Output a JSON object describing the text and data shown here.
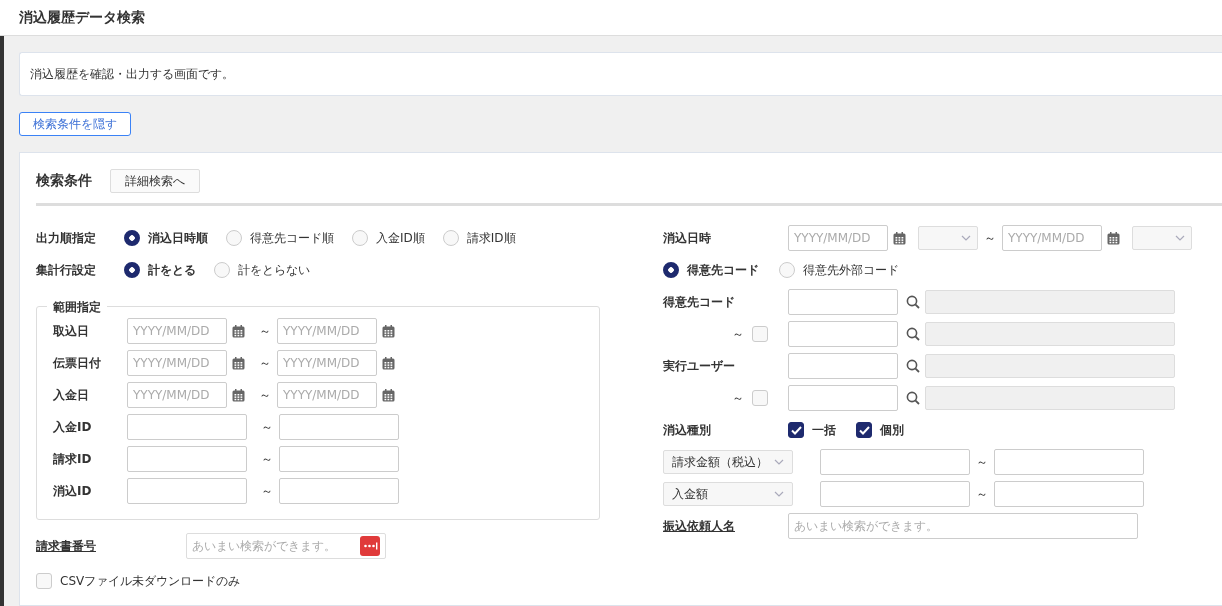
{
  "title": "消込履歴データ検索",
  "description": "消込履歴を確認・出力する画面です。",
  "toggle_button": "検索条件を隠す",
  "conditions": {
    "heading": "検索条件",
    "detail_button": "詳細検索へ"
  },
  "radio_groups": [
    {
      "label": "出力順指定",
      "options": [
        {
          "label": "消込日時順",
          "selected": true
        },
        {
          "label": "得意先コード順",
          "selected": false
        },
        {
          "label": "入金ID順",
          "selected": false
        },
        {
          "label": "請求ID順",
          "selected": false
        }
      ]
    },
    {
      "label": "集計行設定",
      "options": [
        {
          "label": "計をとる",
          "selected": true
        },
        {
          "label": "計をとらない",
          "selected": false
        }
      ]
    }
  ],
  "range": {
    "legend": "範囲指定",
    "rows": [
      {
        "label": "取込日",
        "kind": "date",
        "from_placeholder": "YYYY/MM/DD",
        "tilde": "～",
        "to_placeholder": "YYYY/MM/DD"
      },
      {
        "label": "伝票日付",
        "kind": "date",
        "from_placeholder": "YYYY/MM/DD",
        "tilde": "～",
        "to_placeholder": "YYYY/MM/DD"
      },
      {
        "label": "入金日",
        "kind": "date",
        "from_placeholder": "YYYY/MM/DD",
        "tilde": "～",
        "to_placeholder": "YYYY/MM/DD"
      },
      {
        "label": "入金ID",
        "kind": "text",
        "tilde": "～"
      },
      {
        "label": "請求ID",
        "kind": "text",
        "tilde": "～"
      },
      {
        "label": "消込ID",
        "kind": "text",
        "tilde": "～"
      }
    ]
  },
  "invoice_number": {
    "label": "請求書番号",
    "placeholder": "あいまい検索ができます。"
  },
  "csv_only": {
    "label": "CSVファイル未ダウンロードのみ",
    "checked": false
  },
  "cleared_datetime": {
    "label": "消込日時",
    "from_placeholder": "YYYY/MM/DD",
    "tilde": "～",
    "to_placeholder": "YYYY/MM/DD"
  },
  "code_type": [
    {
      "label": "得意先コード",
      "selected": true
    },
    {
      "label": "得意先外部コード",
      "selected": false
    }
  ],
  "lookups": [
    {
      "label": "得意先コード",
      "tilde": "～",
      "range_checked": false
    },
    {
      "label": "実行ユーザー",
      "tilde": "～",
      "range_checked": false
    }
  ],
  "clear_type": {
    "label": "消込種別",
    "options": [
      {
        "label": "一括",
        "checked": true
      },
      {
        "label": "個別",
        "checked": true
      }
    ]
  },
  "amount_ranges": [
    {
      "field": "請求金額（税込）",
      "tilde": "～"
    },
    {
      "field": "入金額",
      "tilde": "～"
    }
  ],
  "remitter_name": {
    "label": "振込依頼人名",
    "placeholder": "あいまい検索ができます。"
  }
}
